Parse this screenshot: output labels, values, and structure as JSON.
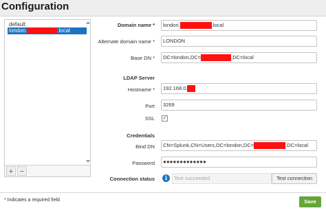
{
  "header": {
    "title": "Configuration"
  },
  "list": {
    "items": [
      {
        "label": "default",
        "selected": false
      },
      {
        "label_prefix": "london.",
        "label_suffix": ".local",
        "selected": true
      }
    ],
    "add_label": "+",
    "remove_label": "−"
  },
  "form": {
    "domain_name": {
      "label": "Domain name *",
      "value_prefix": "london.",
      "value_suffix": ".local"
    },
    "alternate_domain_name": {
      "label": "Alternate domain name *",
      "value": "LONDON"
    },
    "base_dn": {
      "label": "Base DN *",
      "value_prefix": "DC=london,DC=",
      "value_suffix": ",DC=local"
    },
    "ldap_section": "LDAP Server",
    "hostname": {
      "label": "Hostname *",
      "value_prefix": "192.168.0."
    },
    "port": {
      "label": "Port",
      "value": "3269"
    },
    "ssl": {
      "label": "SSL",
      "checked": true,
      "check_glyph": "✓"
    },
    "credentials_section": "Credentials",
    "bind_dn": {
      "label": "Bind DN",
      "value_prefix": "CN=Splunk,CN=Users,DC=london,DC=",
      "value_suffix": ",DC=local"
    },
    "password": {
      "label": "Password",
      "value": "●●●●●●●●●●●●●"
    },
    "connection_status": {
      "label": "Connection status",
      "value": "Test succeeded",
      "info_glyph": "i"
    },
    "test_button": "Test connection"
  },
  "footer": {
    "note": "* Indicates a required field",
    "save_label": "Save"
  },
  "colors": {
    "accent": "#1e73be",
    "save": "#65a637",
    "redaction": "#ff1111"
  }
}
